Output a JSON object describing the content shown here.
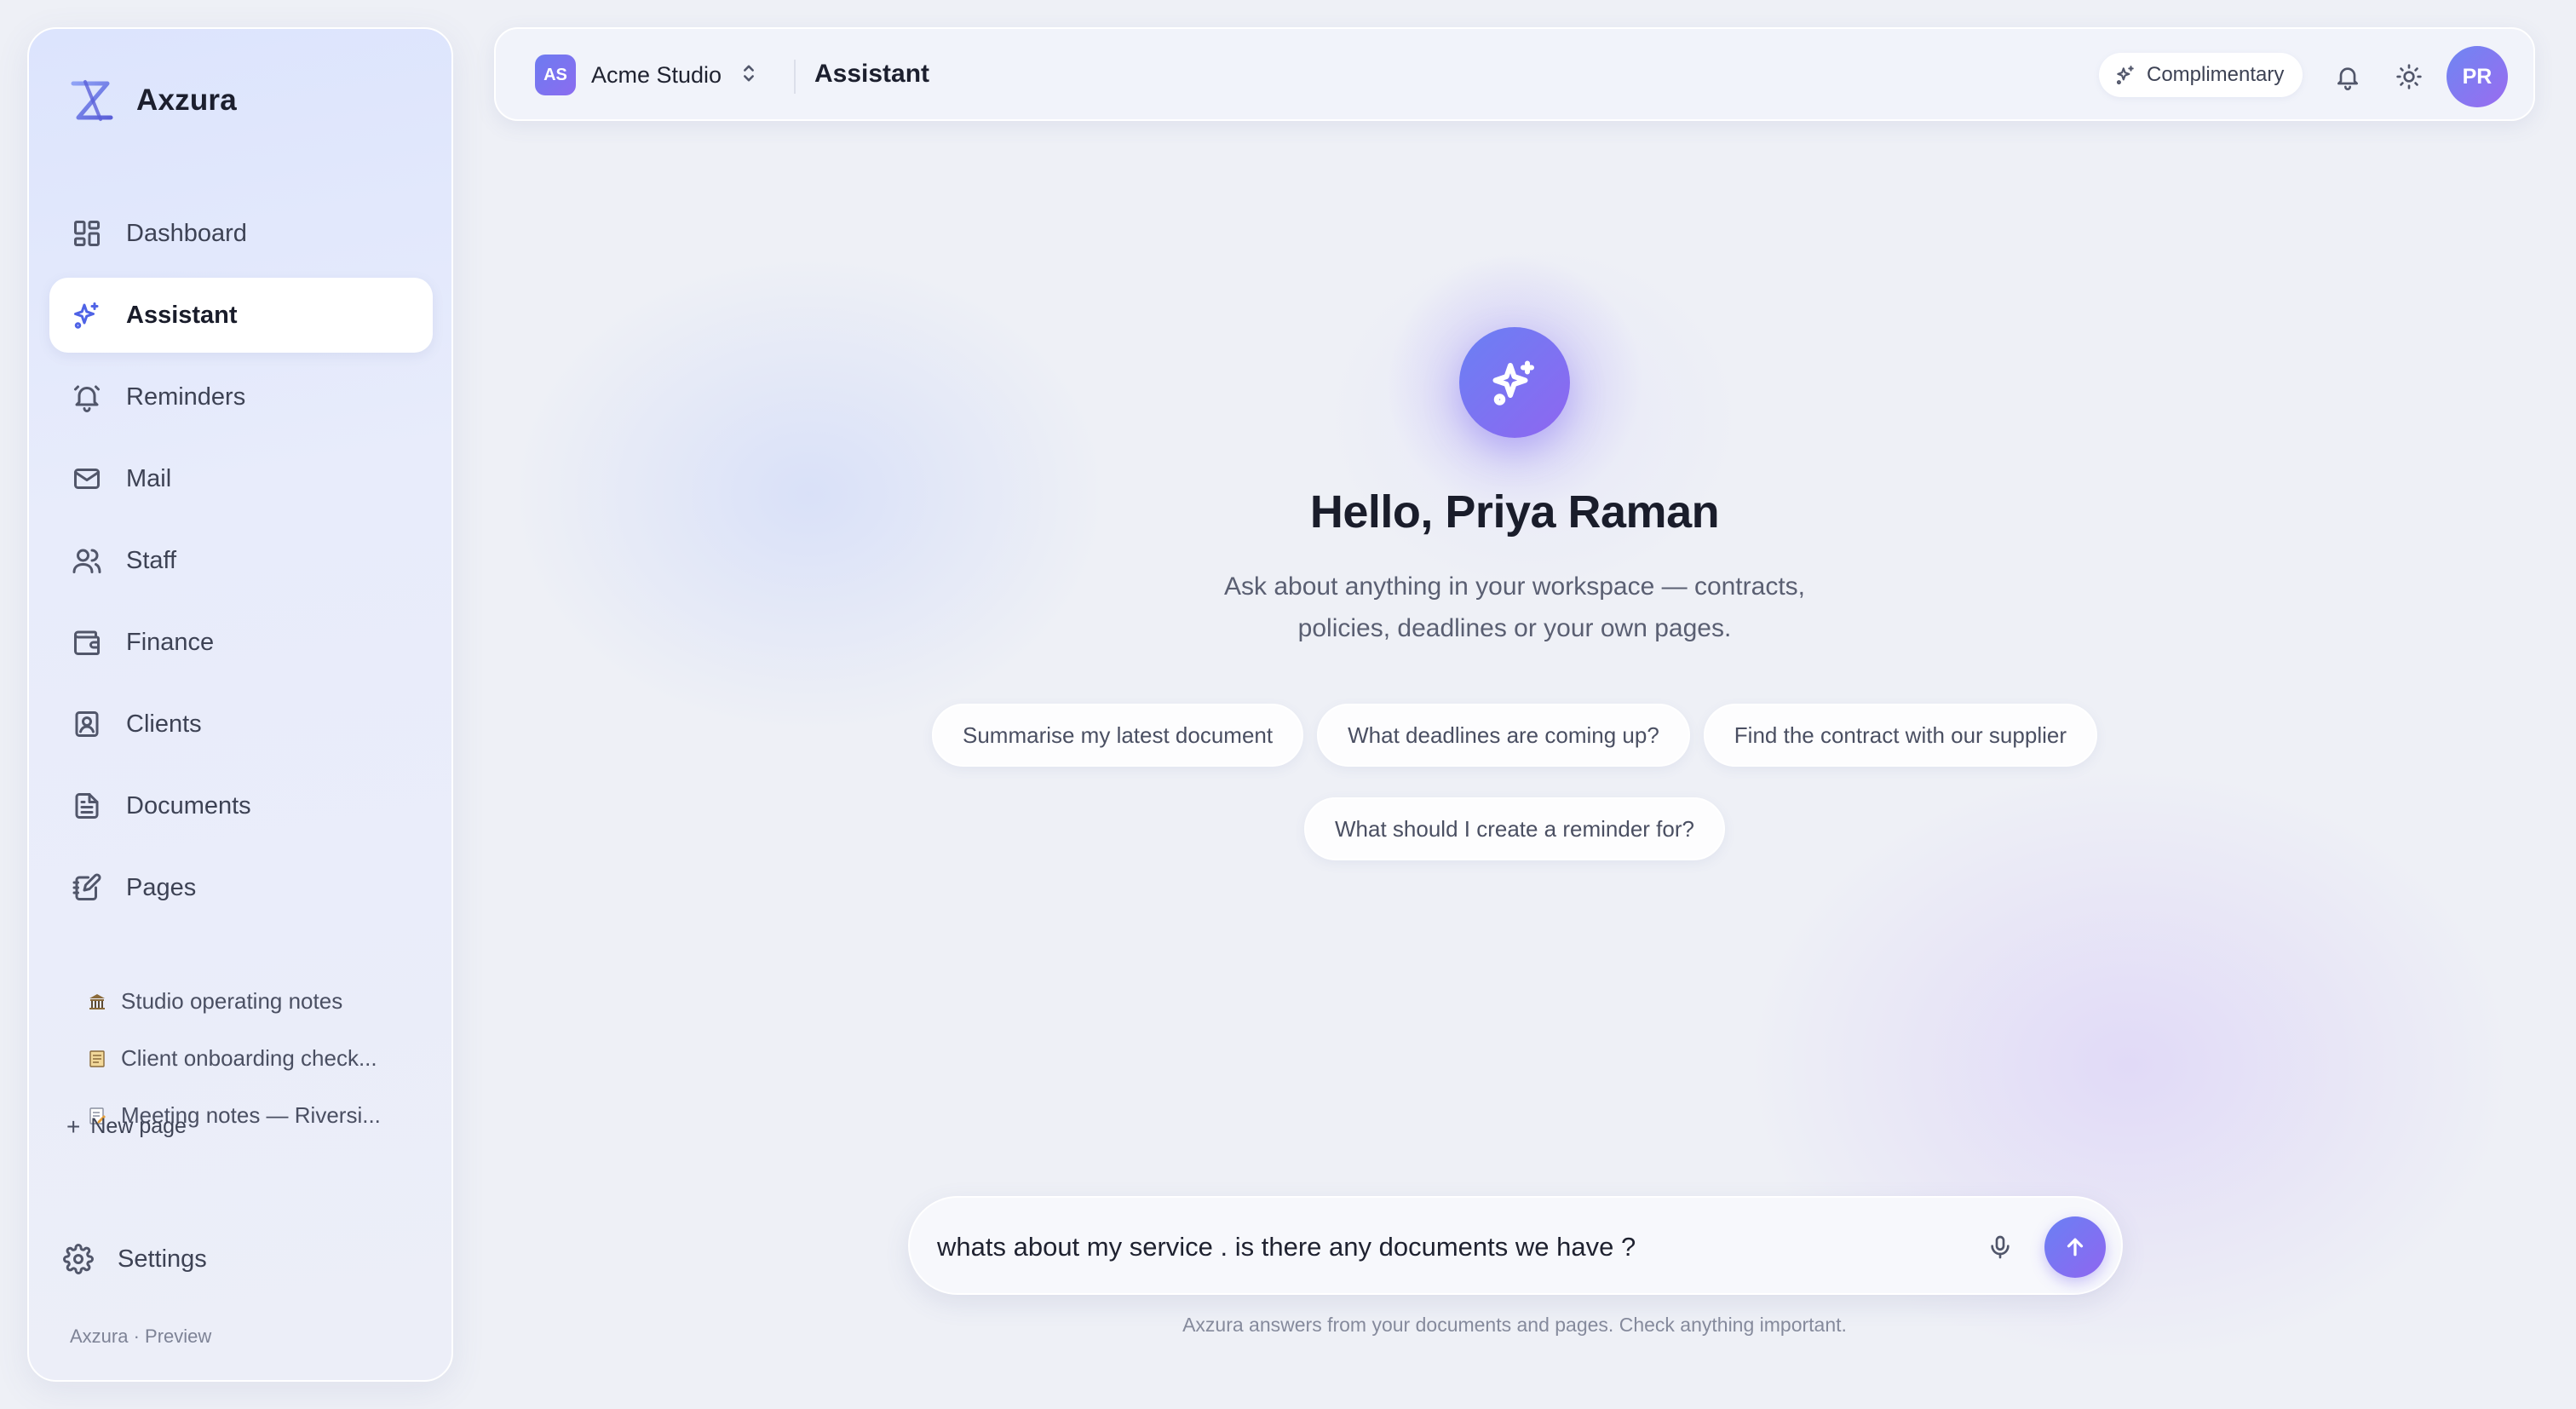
{
  "app": {
    "name": "Axzura",
    "footer": "Axzura · Preview"
  },
  "sidebar": {
    "items": [
      {
        "label": "Dashboard",
        "icon": "dashboard-icon"
      },
      {
        "label": "Assistant",
        "icon": "sparkles-icon",
        "active": true
      },
      {
        "label": "Reminders",
        "icon": "bell-icon"
      },
      {
        "label": "Mail",
        "icon": "mail-icon"
      },
      {
        "label": "Staff",
        "icon": "users-icon"
      },
      {
        "label": "Finance",
        "icon": "wallet-icon"
      },
      {
        "label": "Clients",
        "icon": "contact-icon"
      },
      {
        "label": "Documents",
        "icon": "document-icon"
      },
      {
        "label": "Pages",
        "icon": "notebook-icon"
      }
    ],
    "pages": [
      {
        "label": "Studio operating notes",
        "icon": "classical-building-emoji"
      },
      {
        "label": "Client onboarding check...",
        "icon": "ledger-emoji"
      },
      {
        "label": "Meeting notes — Riversi...",
        "icon": "memo-emoji"
      }
    ],
    "new_page": "New page",
    "settings": "Settings"
  },
  "topbar": {
    "workspace_initials": "AS",
    "workspace_name": "Acme Studio",
    "title": "Assistant",
    "plan": "Complimentary",
    "avatar_initials": "PR"
  },
  "hero": {
    "title": "Hello, Priya Raman",
    "subtitle_line1": "Ask about anything in your workspace — contracts,",
    "subtitle_line2": "policies, deadlines or your own pages."
  },
  "suggestions": [
    "Summarise my latest document",
    "What deadlines are coming up?",
    "Find the contract with our supplier",
    "What should I create a reminder for?"
  ],
  "composer": {
    "value": "whats about my service . is there any documents we have ?",
    "disclaimer": "Axzura answers from your documents and pages. Check anything important."
  },
  "colors": {
    "accent": "#6a80f4",
    "accent2": "#8f66f0",
    "background": "#eef0f6"
  }
}
